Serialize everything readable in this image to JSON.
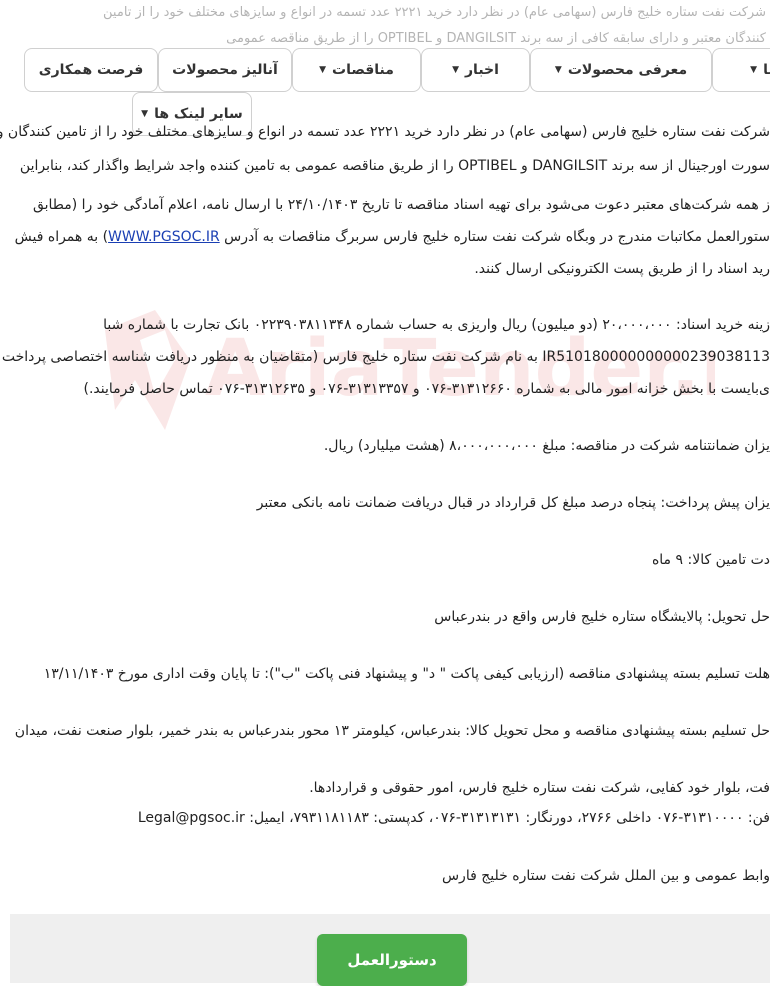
{
  "header_fade": {
    "line1": "شرکت نفت ستاره خلیج فارس (سهامی عام) در نظر دارد خرید ۲۲۲۱ عدد تسمه در انواع و سایزهای مختلف خود را از تامین",
    "line2": "کنندگان معتبر و دارای سابقه کافی از سه برند DANGILSIT و OPTIBEL را از طریق مناقصه عمومی"
  },
  "nav": {
    "items": [
      {
        "label": "فرصت همکاری",
        "has_caret": false
      },
      {
        "label": "آنالیز محصولات",
        "has_caret": false
      },
      {
        "label": "مناقصات",
        "has_caret": true
      },
      {
        "label": "اخبار",
        "has_caret": true
      },
      {
        "label": "معرفی محصولات",
        "has_caret": true
      },
      {
        "label": "ما",
        "has_caret": true
      },
      {
        "label": "سایر لینک ها",
        "has_caret": true
      }
    ]
  },
  "body": {
    "para1_line1": "شرکت نفت ستاره خلیج فارس (سهامی عام) در نظر دارد خرید ۲۲۲۱ عدد تسمه در انواع و سایزهای مختلف خود را از تامین کنندگان و",
    "para1_line2": "سورت اورجینال از سه برند DANGILSIT و OPTIBEL را از طریق مناقصه عمومی به تامین کننده واجد شرایط واگذار کند، بنابراین",
    "para1_line3": "ز همه شرکت‌های معتبر دعوت می‌شود برای تهیه اسناد مناقصه تا تاریخ ۲۴/۱۰/۱۴۰۳ با ارسال نامه، اعلام آمادگی خود را (مطابق",
    "para1_line4_pre": "ستورالعمل مکاتبات مندرج در وبگاه شرکت نفت ستاره خلیج فارس سربرگ مناقصات به آدرس ",
    "para1_link": "WWW.PGSOC.IR",
    "para1_line4_post": ") به همراه فیش",
    "para1_line5": "رید اسناد را از طریق پست الکترونیکی ارسال کنند.",
    "para2_line1": "زینه خرید اسناد: ۲۰،۰۰۰،۰۰۰ (دو میلیون) ریال واریزی به حساب شماره ۰۲۲۳۹۰۳۸۱۱۳۴۸ بانک تجارت با شماره شبا",
    "para2_line2": "IR510180000000000239038113 به نام شرکت نفت ستاره خلیج فارس (متقاضیان به منظور دریافت شناسه اختصاصی پرداخت",
    "para2_line3": "ی‌بایست با بخش خزانه امور مالی به شماره ۳۱۳۱۲۶۶۰-۰۷۶ و ۳۱۳۱۳۳۵۷-۰۷۶ و ۳۱۳۱۲۶۳۵-۰۷۶ تماس حاصل فرمایند.)",
    "guarantee": "یزان ضمانتنامه شرکت در مناقصه: مبلغ ۸،۰۰۰،۰۰۰،۰۰۰ (هشت میلیارد) ریال.",
    "prepayment": "یزان پیش پرداخت: پنجاه درصد مبلغ کل قرارداد در قبال دریافت ضمانت نامه بانکی معتبر",
    "supply_time": "دت تامین کالا: ۹ ماه",
    "delivery_place": "حل تحویل: پالایشگاه ستاره خلیج فارس واقع در بندرعباس",
    "deadline": "هلت تسلیم بسته پیشنهادی مناقصه (ارزیابی کیفی پاکت \" د\" و پیشنهاد فنی پاکت \"ب\"): تا پایان وقت اداری مورخ ۱۳/۱۱/۱۴۰۳",
    "address_line1": "حل تسلیم بسته پیشنهادی مناقصه و محل تحویل کالا: بندرعباس، کیلومتر ۱۳ محور بندرعباس به بندر خمیر، بلوار صنعت نفت، میدان",
    "address_line2": "فت، بلوار خود کفایی، شرکت نفت ستاره خلیج فارس، امور حقوقی و قراردادها.",
    "contact": "فن: ۳۱۳۱۰۰۰۰-۰۷۶ داخلی ۲۷۶۶، دورنگار: ۳۱۳۱۳۱۳۱-۰۷۶، کدپستی: ۷۹۳۱۱۸۱۱۸۳، ایمیل: Legal@pgsoc.ir",
    "signature": "وابط عمومی و بین الملل شرکت نفت ستاره خلیج فارس"
  },
  "watermark": {
    "text": "AriaTender.neT"
  },
  "footer": {
    "button_label": "دستورالعمل"
  },
  "colors": {
    "accent_green": "#4cae4c",
    "link_blue": "#1a3fb3",
    "watermark_red": "#d32f2f"
  }
}
